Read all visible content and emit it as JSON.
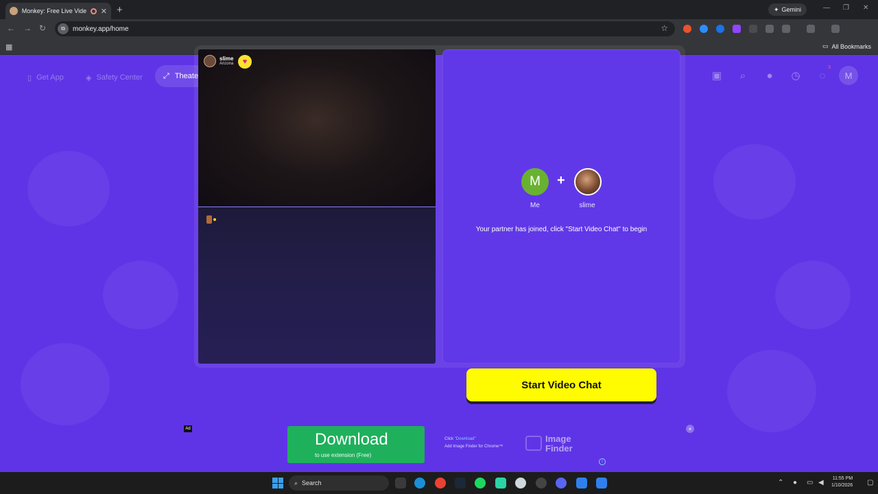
{
  "browser": {
    "tab_title": "Monkey: Free Live Video Ch",
    "new_tab": "+",
    "gemini": "Gemini",
    "url": "monkey.app/home",
    "all_bookmarks": "All Bookmarks",
    "profile_initial": "M"
  },
  "nav": {
    "get_app": "Get App",
    "safety_center": "Safety Center",
    "theater_mode": "Theater Mode",
    "messages_badge": "3",
    "me_initial": "M"
  },
  "video": {
    "partner_name": "slime",
    "partner_location": "Arizona"
  },
  "panel": {
    "me_initial": "M",
    "me_label": "Me",
    "plus": "+",
    "partner_label": "slime",
    "joined_text": "Your partner has joined, click \"Start Video Chat\" to begin",
    "start_button": "Start Video Chat"
  },
  "ad": {
    "label": "Ad",
    "download": "Download",
    "download_sub": "to use extension (Free)",
    "click_prefix": "Click ",
    "click_word": "\"Download\"",
    "add_text": "Add Image Finder for Chrome™",
    "brand_line1": "Image",
    "brand_line2": "Finder",
    "close": "×",
    "info": "i"
  },
  "taskbar": {
    "search": "Search",
    "time": "11:55 PM",
    "date": "1/10/2026"
  },
  "colors": {
    "page_bg": "#5f34e6",
    "start_button": "#fffb00",
    "download_button": "#1fb05c",
    "me_avatar": "#69b231"
  }
}
